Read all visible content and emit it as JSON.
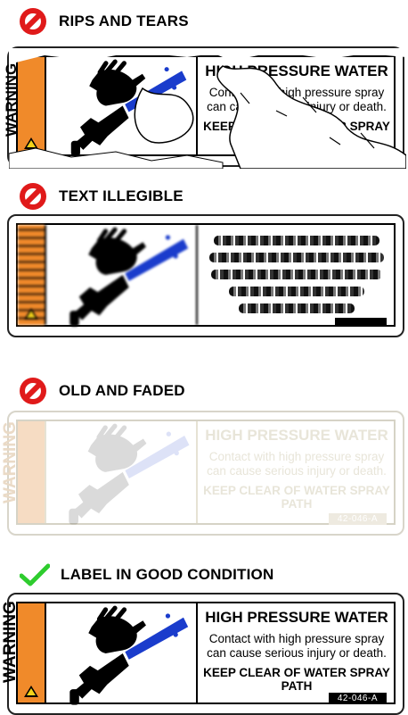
{
  "sections": [
    {
      "status": "bad",
      "heading": "RIPS AND TEARS"
    },
    {
      "status": "bad",
      "heading": "TEXT ILLEGIBLE"
    },
    {
      "status": "bad",
      "heading": "OLD AND FADED"
    },
    {
      "status": "good",
      "heading": "LABEL IN GOOD CONDITION"
    }
  ],
  "label": {
    "warning_word": "WARNING",
    "title": "HIGH PRESSURE WATER",
    "body": "Contact with high pressure spray can cause serious injury or death.",
    "instruction": "KEEP CLEAR OF WATER SPRAY PATH",
    "code": "42-046-A"
  },
  "colors": {
    "bad_icon": "#e01a1a",
    "good_icon": "#2ecc2e",
    "warning_strip": "#f08a2a",
    "spray": "#1a3ccc"
  }
}
